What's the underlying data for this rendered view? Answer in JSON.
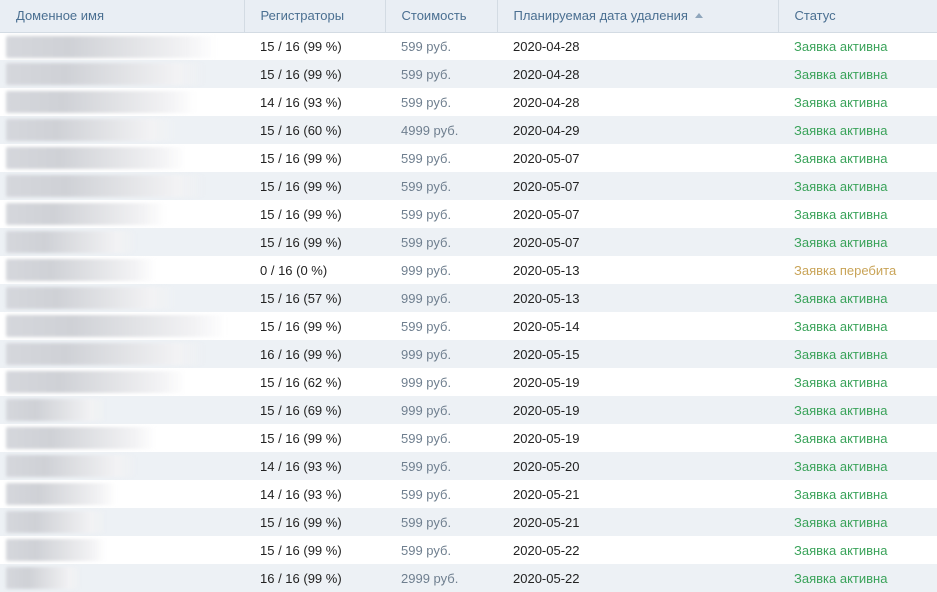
{
  "columns": {
    "domain": "Доменное имя",
    "registrars": "Регистраторы",
    "cost": "Стоимость",
    "delete_date": "Планируемая дата удаления",
    "status": "Статус"
  },
  "sort": {
    "column": "delete_date",
    "direction": "asc",
    "icon": "sort-ascending-icon"
  },
  "colors": {
    "active": "#3aa35a",
    "outbid": "#c9a458",
    "header_text": "#4a6f91"
  },
  "rows": [
    {
      "domain": "",
      "registrars": "15 / 16 (99 %)",
      "cost": "599 руб.",
      "date": "2020-04-28",
      "status": "Заявка активна",
      "state": "active"
    },
    {
      "domain": "",
      "registrars": "15 / 16 (99 %)",
      "cost": "599 руб.",
      "date": "2020-04-28",
      "status": "Заявка активна",
      "state": "active"
    },
    {
      "domain": "",
      "registrars": "14 / 16 (93 %)",
      "cost": "599 руб.",
      "date": "2020-04-28",
      "status": "Заявка активна",
      "state": "active"
    },
    {
      "domain": "",
      "registrars": "15 / 16 (60 %)",
      "cost": "4999 руб.",
      "date": "2020-04-29",
      "status": "Заявка активна",
      "state": "active"
    },
    {
      "domain": "",
      "registrars": "15 / 16 (99 %)",
      "cost": "599 руб.",
      "date": "2020-05-07",
      "status": "Заявка активна",
      "state": "active"
    },
    {
      "domain": "",
      "registrars": "15 / 16 (99 %)",
      "cost": "599 руб.",
      "date": "2020-05-07",
      "status": "Заявка активна",
      "state": "active"
    },
    {
      "domain": "",
      "registrars": "15 / 16 (99 %)",
      "cost": "599 руб.",
      "date": "2020-05-07",
      "status": "Заявка активна",
      "state": "active"
    },
    {
      "domain": "",
      "registrars": "15 / 16 (99 %)",
      "cost": "599 руб.",
      "date": "2020-05-07",
      "status": "Заявка активна",
      "state": "active"
    },
    {
      "domain": "",
      "registrars": "0 / 16 (0 %)",
      "cost": "999 руб.",
      "date": "2020-05-13",
      "status": "Заявка перебита",
      "state": "outbid"
    },
    {
      "domain": "",
      "registrars": "15 / 16 (57 %)",
      "cost": "999 руб.",
      "date": "2020-05-13",
      "status": "Заявка активна",
      "state": "active"
    },
    {
      "domain": "",
      "registrars": "15 / 16 (99 %)",
      "cost": "599 руб.",
      "date": "2020-05-14",
      "status": "Заявка активна",
      "state": "active"
    },
    {
      "domain": "",
      "registrars": "16 / 16 (99 %)",
      "cost": "999 руб.",
      "date": "2020-05-15",
      "status": "Заявка активна",
      "state": "active"
    },
    {
      "domain": "",
      "registrars": "15 / 16 (62 %)",
      "cost": "999 руб.",
      "date": "2020-05-19",
      "status": "Заявка активна",
      "state": "active"
    },
    {
      "domain": "",
      "registrars": "15 / 16 (69 %)",
      "cost": "999 руб.",
      "date": "2020-05-19",
      "status": "Заявка активна",
      "state": "active"
    },
    {
      "domain": "",
      "registrars": "15 / 16 (99 %)",
      "cost": "599 руб.",
      "date": "2020-05-19",
      "status": "Заявка активна",
      "state": "active"
    },
    {
      "domain": "",
      "registrars": "14 / 16 (93 %)",
      "cost": "599 руб.",
      "date": "2020-05-20",
      "status": "Заявка активна",
      "state": "active"
    },
    {
      "domain": "",
      "registrars": "14 / 16 (93 %)",
      "cost": "599 руб.",
      "date": "2020-05-21",
      "status": "Заявка активна",
      "state": "active"
    },
    {
      "domain": "",
      "registrars": "15 / 16 (99 %)",
      "cost": "599 руб.",
      "date": "2020-05-21",
      "status": "Заявка активна",
      "state": "active"
    },
    {
      "domain": "",
      "registrars": "15 / 16 (99 %)",
      "cost": "599 руб.",
      "date": "2020-05-22",
      "status": "Заявка активна",
      "state": "active"
    },
    {
      "domain": "",
      "registrars": "16 / 16 (99 %)",
      "cost": "2999 руб.",
      "date": "2020-05-22",
      "status": "Заявка активна",
      "state": "active"
    }
  ]
}
